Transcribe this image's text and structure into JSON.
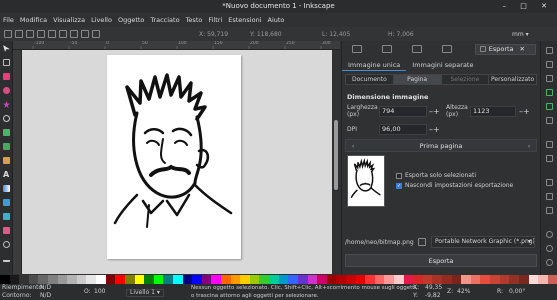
{
  "window": {
    "title": "*Nuovo documento 1 - Inkscape",
    "controls": [
      "–",
      "□",
      "✕"
    ]
  },
  "menu": [
    "File",
    "Modifica",
    "Visualizza",
    "Livello",
    "Oggetto",
    "Tracciato",
    "Testo",
    "Filtri",
    "Estensioni",
    "Aiuto"
  ],
  "command_bar": {
    "x_label": "X:",
    "x_value": "59,719",
    "y_label": "Y:",
    "y_value": "118,680",
    "w_label": "L:",
    "w_value": "12,405",
    "h_label": "H:",
    "h_value": "7,006",
    "unit": "mm"
  },
  "ruler_ticks": [
    "-100",
    "-50",
    "0",
    "50",
    "100",
    "150",
    "200",
    "250",
    "300"
  ],
  "export_panel": {
    "tab_title": "Esporta",
    "mode_tabs": [
      "Immagine unica",
      "Immagini separate"
    ],
    "area_buttons": [
      "Documento",
      "Pagina",
      "Selezione",
      "Personalizzato"
    ],
    "section_title": "Dimensione immagine",
    "width_label": "Larghezza (px)",
    "width_value": "794",
    "height_label": "Altezza (px)",
    "height_value": "1123",
    "dpi_label": "DPI",
    "dpi_value": "96,00",
    "page_nav_label": "Prima pagina",
    "checkbox_selected_only": "Esporta solo selezionati",
    "checkbox_selected_only_checked": false,
    "checkbox_hide_settings": "Nascondi impostazioni esportazione",
    "checkbox_hide_settings_checked": true,
    "file_path": "/home/neo/bitmap.png",
    "format": "Portable Network Graphic (*.png)",
    "export_button": "Esporta"
  },
  "status": {
    "fill_label": "Riempimento:",
    "fill_value": "N/D",
    "stroke_label": "Contorno:",
    "stroke_value": "N/D",
    "opacity_label": "O:",
    "opacity_value": "100",
    "layer": "Livello 1",
    "message_line1": "Nessun oggetto selezionato. Clic, Shift+Clic, Alt+scorrimento mouse sugli oggetti,",
    "message_line2": "o trascina attorno agli oggetti per selezionare.",
    "cursor_x_label": "X:",
    "cursor_x": "49,35",
    "cursor_y_label": "Y:",
    "cursor_y": "-9,82",
    "zoom_label": "Z:",
    "zoom": "42%",
    "rotation_label": "R:",
    "rotation": "0,00°"
  },
  "colors": {
    "accent": "#3d7bd6",
    "canvas": "#d9d9d9",
    "page": "#ffffff",
    "palette": [
      "#000000",
      "#1a1a1a",
      "#333333",
      "#4d4d4d",
      "#666666",
      "#808080",
      "#999999",
      "#b3b3b3",
      "#cccccc",
      "#e6e6e6",
      "#ffffff",
      "#800000",
      "#ff0000",
      "#808000",
      "#ffff00",
      "#008000",
      "#00ff00",
      "#008080",
      "#00ffff",
      "#000080",
      "#0000ff",
      "#800080",
      "#ff00ff",
      "#ff6600",
      "#ff9900",
      "#ffcc00",
      "#99cc00",
      "#33cc33",
      "#00cc99",
      "#0099cc",
      "#3366ff",
      "#6633cc",
      "#cc33cc",
      "#cc0066",
      "#990000",
      "#b30000",
      "#cc0000",
      "#e60000",
      "#ff3333",
      "#ff6666",
      "#ff9999",
      "#ffcccc",
      "#e6194b",
      "#d62728",
      "#c0392b",
      "#a93226",
      "#922b21",
      "#7b241c",
      "#f1948a",
      "#ec7063",
      "#e74c3c",
      "#cb4335",
      "#b03a2e",
      "#943126",
      "#78281f",
      "#fadbd8",
      "#f5b7b1",
      "#cd6155"
    ]
  },
  "icons": [
    "selector-icon",
    "node-icon",
    "rect-icon",
    "circle-icon",
    "star-icon",
    "spiral-icon",
    "pen-icon",
    "pencil-icon",
    "calligraphy-icon",
    "text-icon",
    "gradient-icon",
    "dropper-icon",
    "bucket-icon",
    "eraser-icon",
    "zoom-icon",
    "measure-icon"
  ]
}
